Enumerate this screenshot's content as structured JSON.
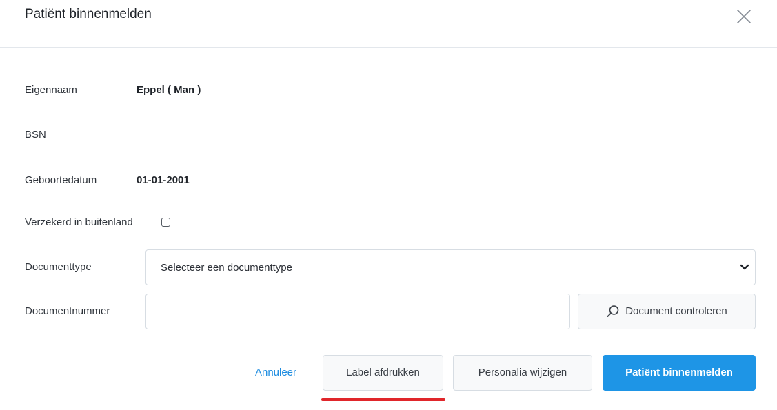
{
  "dialog": {
    "title": "Patiënt binnenmelden"
  },
  "fields": {
    "eigennaam_label": "Eigennaam",
    "eigennaam_value": "Eppel ( Man )",
    "bsn_label": "BSN",
    "bsn_value": "",
    "geboortedatum_label": "Geboortedatum",
    "geboortedatum_value": "01-01-2001",
    "verzekerd_label": "Verzekerd in buitenland",
    "documenttype_label": "Documenttype",
    "documenttype_selected": "Selecteer een documenttype",
    "documentnummer_label": "Documentnummer",
    "documentnummer_value": ""
  },
  "buttons": {
    "document_controleren": "Document controleren",
    "annuleer": "Annuleer",
    "label_afdrukken": "Label afdrukken",
    "personalia_wijzigen": "Personalia wijzigen",
    "patient_binnenmelden": "Patiënt binnenmelden"
  },
  "icons": {
    "close": "close-icon",
    "chevron": "chevron-down-icon",
    "search": "search-icon"
  },
  "colors": {
    "primary": "#1e95e6",
    "link": "#1d8ce0",
    "highlight_underline": "#e0262b"
  }
}
